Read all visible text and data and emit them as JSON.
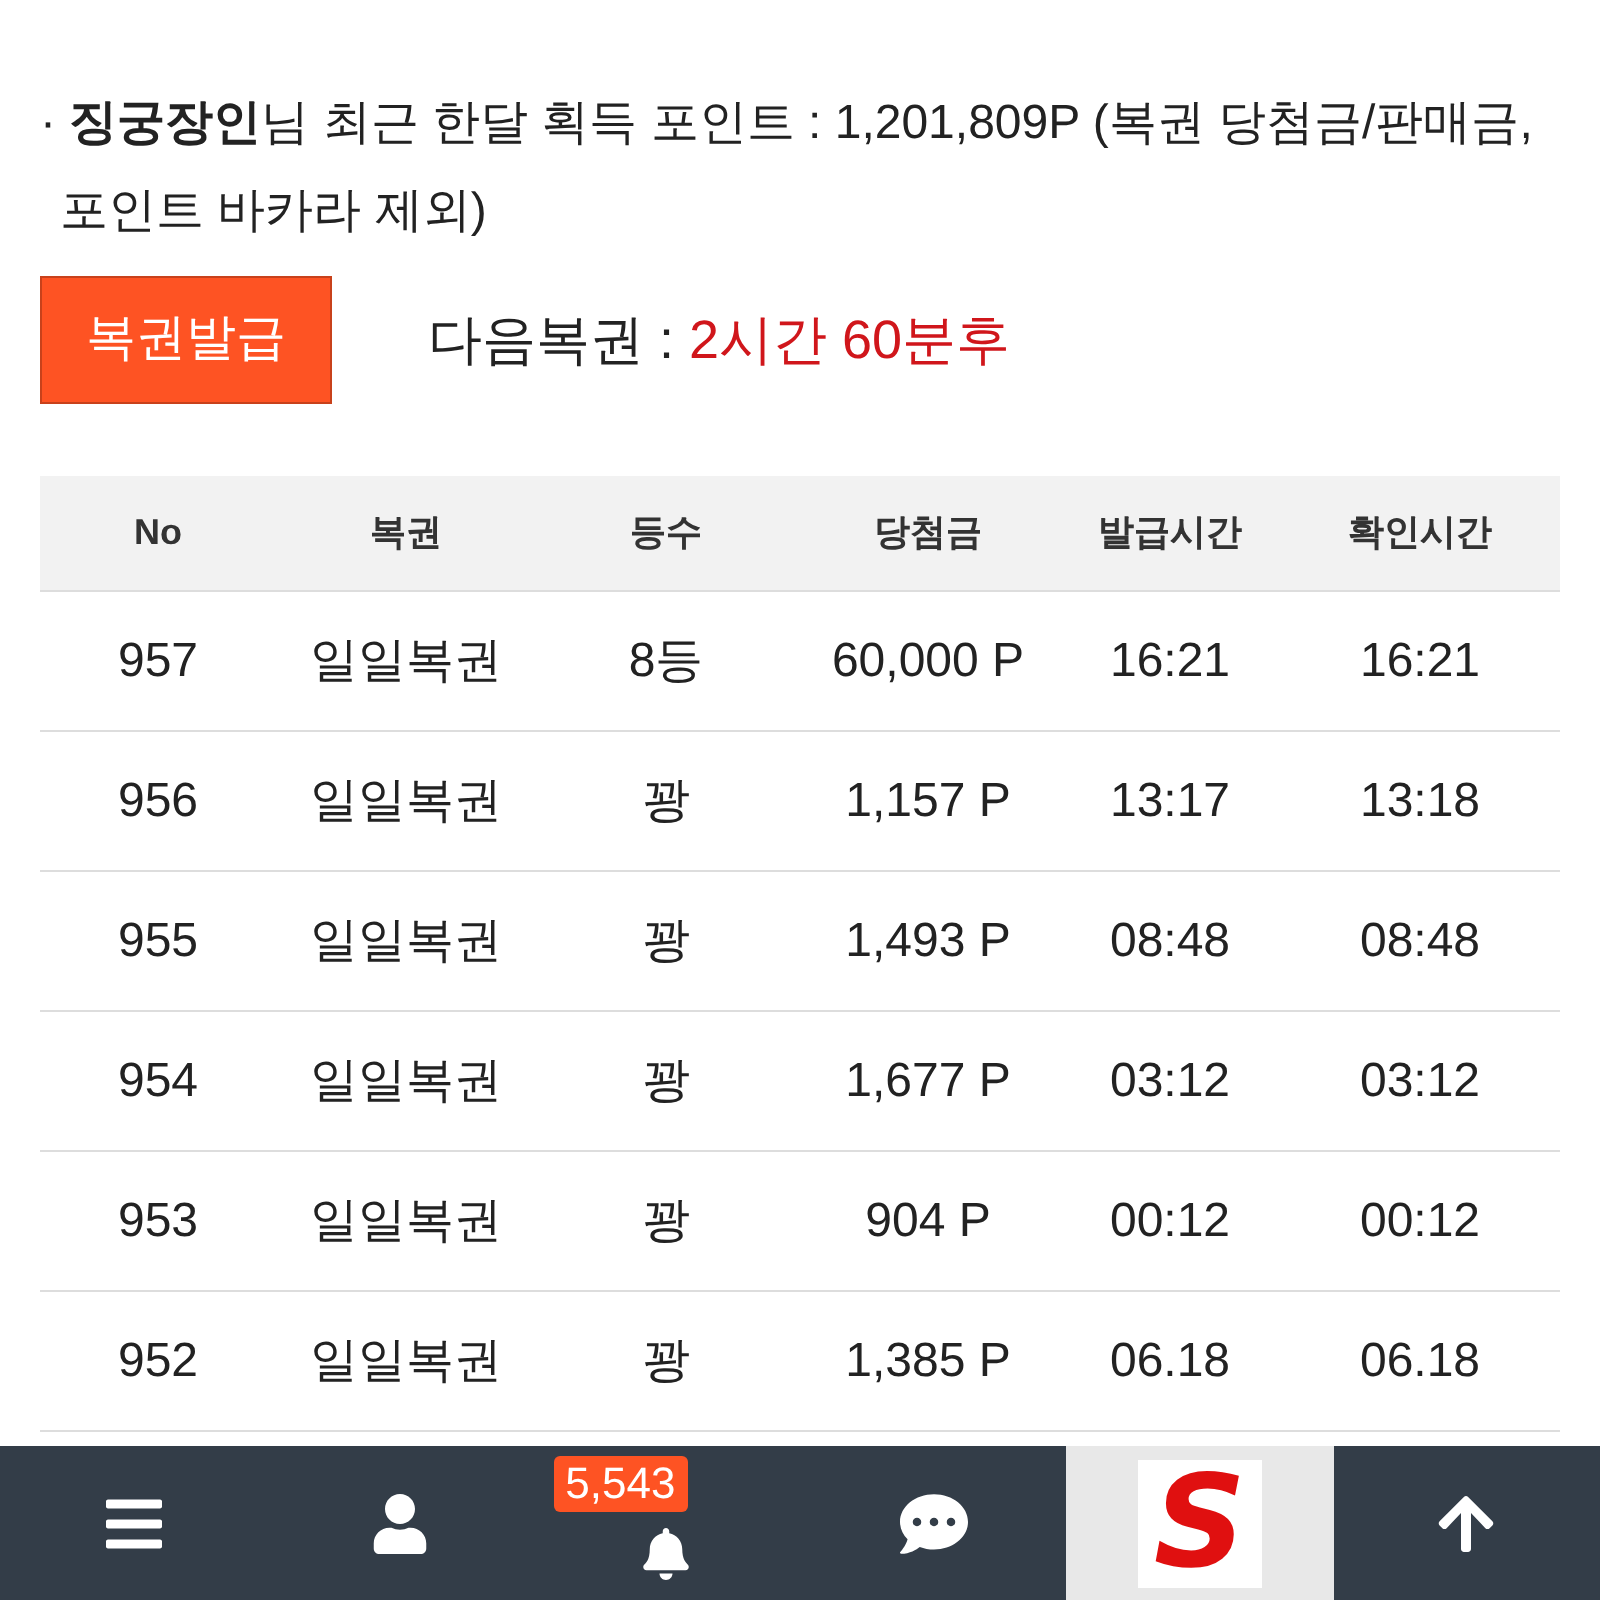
{
  "notice": {
    "text": "· **징궁장인**님 최근 한달 획득 포인트 : 1,201,809P (복권 당첨금/판매금, 포인트 바카라 제외)"
  },
  "issue_button": {
    "label": "복권발급"
  },
  "next_lottery": {
    "label": "다음복권 : ",
    "value": "2시간 60분후"
  },
  "table": {
    "columns": [
      "No",
      "복권",
      "등수",
      "당첨금",
      "발급시간",
      "확인시간"
    ],
    "rows": [
      [
        "957",
        "일일복권",
        "8등",
        "60,000 P",
        "16:21",
        "16:21"
      ],
      [
        "956",
        "일일복권",
        "꽝",
        "1,157 P",
        "13:17",
        "13:18"
      ],
      [
        "955",
        "일일복권",
        "꽝",
        "1,493 P",
        "08:48",
        "08:48"
      ],
      [
        "954",
        "일일복권",
        "꽝",
        "1,677 P",
        "03:12",
        "03:12"
      ],
      [
        "953",
        "일일복권",
        "꽝",
        "904 P",
        "00:12",
        "00:12"
      ],
      [
        "952",
        "일일복권",
        "꽝",
        "1,385 P",
        "06.18",
        "06.18"
      ]
    ]
  },
  "bottom_bar": {
    "items": [
      {
        "kind": "menu"
      },
      {
        "kind": "user"
      },
      {
        "kind": "bell",
        "badge": "5,543"
      },
      {
        "kind": "chat"
      },
      {
        "kind": "logo",
        "text": "S"
      },
      {
        "kind": "top"
      }
    ]
  }
}
